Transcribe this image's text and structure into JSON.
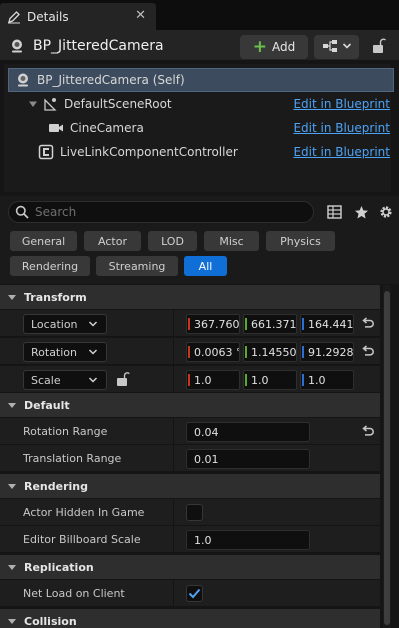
{
  "tab": {
    "label": "Details",
    "close": "✕"
  },
  "header": {
    "title": "BP_JitteredCamera",
    "add_label": "Add"
  },
  "tree": [
    {
      "label": "BP_JitteredCamera (Self)",
      "icon": "actor-icon",
      "edit": ""
    },
    {
      "label": "DefaultSceneRoot",
      "icon": "scene-root-icon",
      "edit": "Edit in Blueprint"
    },
    {
      "label": "CineCamera",
      "icon": "camera-icon",
      "edit": "Edit in Blueprint"
    },
    {
      "label": "LiveLinkComponentController",
      "icon": "livelink-icon",
      "edit": "Edit in Blueprint"
    }
  ],
  "search": {
    "placeholder": "Search"
  },
  "categories": [
    "General",
    "Actor",
    "LOD",
    "Misc",
    "Physics",
    "Rendering",
    "Streaming",
    "All"
  ],
  "active_category": "All",
  "sections": {
    "transform": "Transform",
    "default": "Default",
    "rendering": "Rendering",
    "replication": "Replication",
    "collision": "Collision"
  },
  "transform": {
    "location": {
      "label": "Location",
      "x": "367.760",
      "y": "661.371",
      "z": "164.441"
    },
    "rotation": {
      "label": "Rotation",
      "x": "0.0063 °",
      "y": "1.14550",
      "z": "91.2928"
    },
    "scale": {
      "label": "Scale",
      "x": "1.0",
      "y": "1.0",
      "z": "1.0"
    }
  },
  "default": {
    "rotation_range": {
      "label": "Rotation Range",
      "value": "0.04"
    },
    "translation_range": {
      "label": "Translation Range",
      "value": "0.01"
    }
  },
  "rendering": {
    "actor_hidden": {
      "label": "Actor Hidden In Game",
      "checked": false
    },
    "billboard_scale": {
      "label": "Editor Billboard Scale",
      "value": "1.0"
    }
  },
  "replication": {
    "net_load": {
      "label": "Net Load on Client",
      "checked": true
    }
  },
  "colors": {
    "accent": "#0f6fd6",
    "link": "#4da3f5",
    "x_axis": "#c8361e",
    "y_axis": "#5fa82f",
    "z_axis": "#2d6fd4",
    "add_plus": "#6ac04d"
  }
}
